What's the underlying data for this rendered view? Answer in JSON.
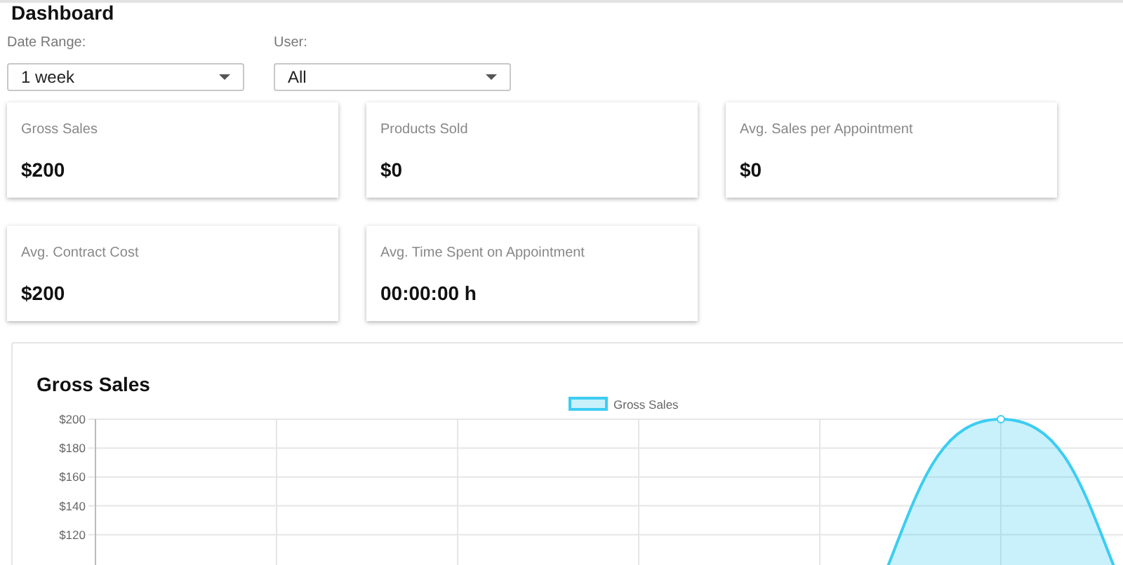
{
  "page_title": "Dashboard",
  "filters": [
    {
      "label": "Date Range:",
      "value": "1 week"
    },
    {
      "label": "User:",
      "value": "All"
    }
  ],
  "stat_cards": [
    [
      {
        "label": "Gross Sales",
        "value": "$200"
      },
      {
        "label": "Products Sold",
        "value": "$0"
      },
      {
        "label": "Avg. Sales per Appointment",
        "value": "$0"
      }
    ],
    [
      {
        "label": "Avg. Contract Cost",
        "value": "$200"
      },
      {
        "label": "Avg. Time Spent on Appointment",
        "value": "00:00:00 h"
      }
    ]
  ],
  "chart_panel": {
    "chart_data": {
      "type": "area",
      "title": "Gross Sales",
      "grid": true,
      "ylim": [
        0,
        200
      ],
      "yticks": [
        {
          "value": 200,
          "label": "$200"
        },
        {
          "value": 180,
          "label": "$180"
        },
        {
          "value": 160,
          "label": "$160"
        },
        {
          "value": 140,
          "label": "$140"
        },
        {
          "value": 120,
          "label": "$120"
        }
      ],
      "series": [
        {
          "name": "Gross Sales",
          "color": "#3ccdf2",
          "values": [
            0,
            0,
            0,
            0,
            0,
            200,
            0
          ]
        }
      ]
    }
  }
}
